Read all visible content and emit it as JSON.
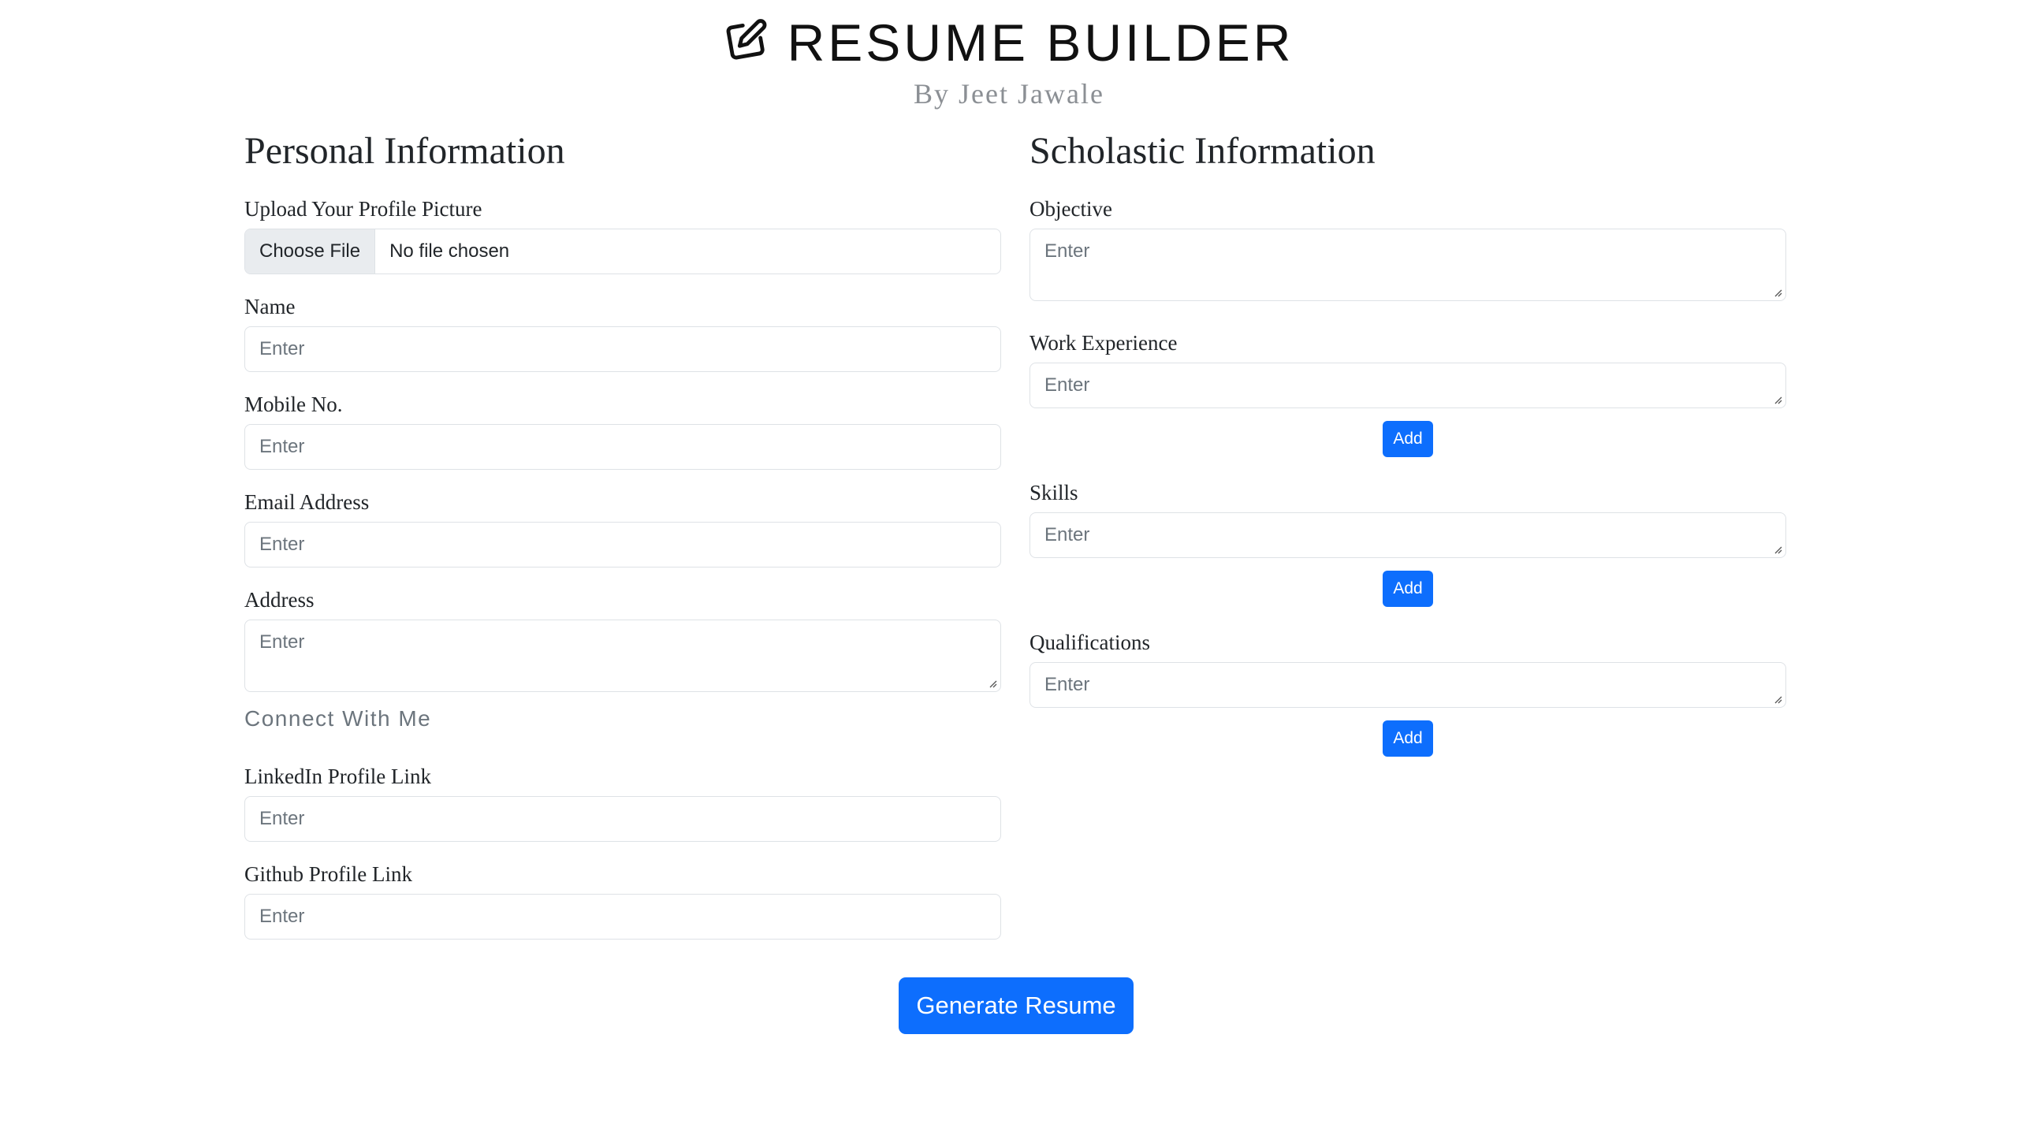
{
  "header": {
    "title": "RESUME BUILDER",
    "subtitle": "By Jeet Jawale",
    "icon": "edit-pencil-square-icon"
  },
  "personal": {
    "section_title": "Personal Information",
    "profile_picture": {
      "label": "Upload Your Profile Picture",
      "button_label": "Choose File",
      "status": "No file chosen"
    },
    "name": {
      "label": "Name",
      "placeholder": "Enter"
    },
    "mobile": {
      "label": "Mobile No.",
      "placeholder": "Enter"
    },
    "email": {
      "label": "Email Address",
      "placeholder": "Enter"
    },
    "address": {
      "label": "Address",
      "placeholder": "Enter"
    },
    "connect_heading": "Connect With Me",
    "linkedin": {
      "label": "LinkedIn Profile Link",
      "placeholder": "Enter"
    },
    "github": {
      "label": "Github Profile Link",
      "placeholder": "Enter"
    }
  },
  "scholastic": {
    "section_title": "Scholastic Information",
    "objective": {
      "label": "Objective",
      "placeholder": "Enter"
    },
    "work_experience": {
      "label": "Work Experience",
      "placeholder": "Enter",
      "add_label": "Add"
    },
    "skills": {
      "label": "Skills",
      "placeholder": "Enter",
      "add_label": "Add"
    },
    "qualifications": {
      "label": "Qualifications",
      "placeholder": "Enter",
      "add_label": "Add"
    }
  },
  "actions": {
    "generate_label": "Generate Resume"
  },
  "colors": {
    "primary": "#0d6efd",
    "border": "#dee2e6",
    "muted": "#6c757d"
  }
}
